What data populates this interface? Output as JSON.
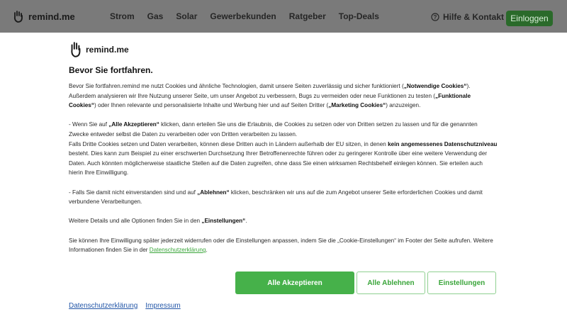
{
  "header": {
    "logo_text": "remind.me",
    "nav": [
      "Strom",
      "Gas",
      "Solar",
      "Gewerbekunden",
      "Ratgeber",
      "Top-Deals"
    ],
    "help_label": "Hilfe & Kontakt",
    "login_label": "Einloggen"
  },
  "modal": {
    "logo_text": "remind.me",
    "title": "Bevor Sie fortfahren.",
    "p1_a": "Bevor Sie fortfahren.remind me nutzt Cookies und ähnliche Technologien, damit unsere Seiten zuverlässig und sicher funktioniert (",
    "p1_b1": "„Notwendige Cookies“",
    "p1_c": "). Außerdem analysieren wir Ihre Nutzung unserer Seite, um unser Angebot zu verbessern, Bugs zu vermeiden oder neue Funktionen zu testen (",
    "p1_b2": "„Funktionale Cookies“",
    "p1_d": ") oder Ihnen relevante und personalisierte Inhalte und Werbung hier und auf Seiten Dritter (",
    "p1_b3": "„Marketing Cookies“",
    "p1_e": ") anzuzeigen.",
    "p2_a": "- Wenn Sie auf ",
    "p2_b": "„Alle Akzeptieren“",
    "p2_c": " klicken, dann erteilen Sie uns die Erlaubnis, die Cookies zu setzen oder von Dritten setzen zu lassen und für die genannten Zwecke entweder selbst die Daten zu verarbeiten oder von Dritten verarbeiten zu lassen.",
    "p3_a": "Falls Dritte Cookies setzen und Daten verarbeiten, können diese Dritten auch in Ländern außerhalb der EU sitzen, in denen ",
    "p3_b": "kein angemessenes Datenschutzniveau",
    "p3_c": " besteht. Dies kann zum Beispiel zu einer erschwerten Durchsetzung Ihrer Betroffenenrechte führen oder zu geringerer Kontrolle über eine weitere Verwendung der Daten. Auch könnten möglicherweise staatliche Stellen auf die Daten zugreifen, ohne dass Sie einen wirksamen Rechtsbehelf einlegen können. Sie erteilen auch hierin Ihre Einwilligung.",
    "p4_a": "- Falls Sie damit nicht einverstanden sind und auf ",
    "p4_b": "„Ablehnen“",
    "p4_c": " klicken, beschränken wir uns auf die zum Angebot unserer Seite erforderlichen Cookies und damit verbundene Verarbeitungen.",
    "p5_a": "Weitere Details und alle Optionen finden Sie in den ",
    "p5_b": "„Einstellungen“",
    "p5_c": ".",
    "p6_a": "Sie können Ihre Einwilligung später jederzeit widerrufen oder die Einstellungen anpassen, indem Sie die „Cookie-Einstellungen“ im Footer der Seite aufrufen. Weitere Informationen finden Sie in der ",
    "p6_link": "Datenschutzerklärung",
    "p6_c": ".",
    "accept_label": "Alle Akzeptieren",
    "reject_label": "Alle Ablehnen",
    "settings_label": "Einstellungen",
    "footer_privacy": "Datenschutzerklärung",
    "footer_imprint": "Impressum"
  },
  "colors": {
    "accent_green": "#46b14a",
    "link_green": "#3aa53a",
    "footer_link": "#2457a8"
  }
}
